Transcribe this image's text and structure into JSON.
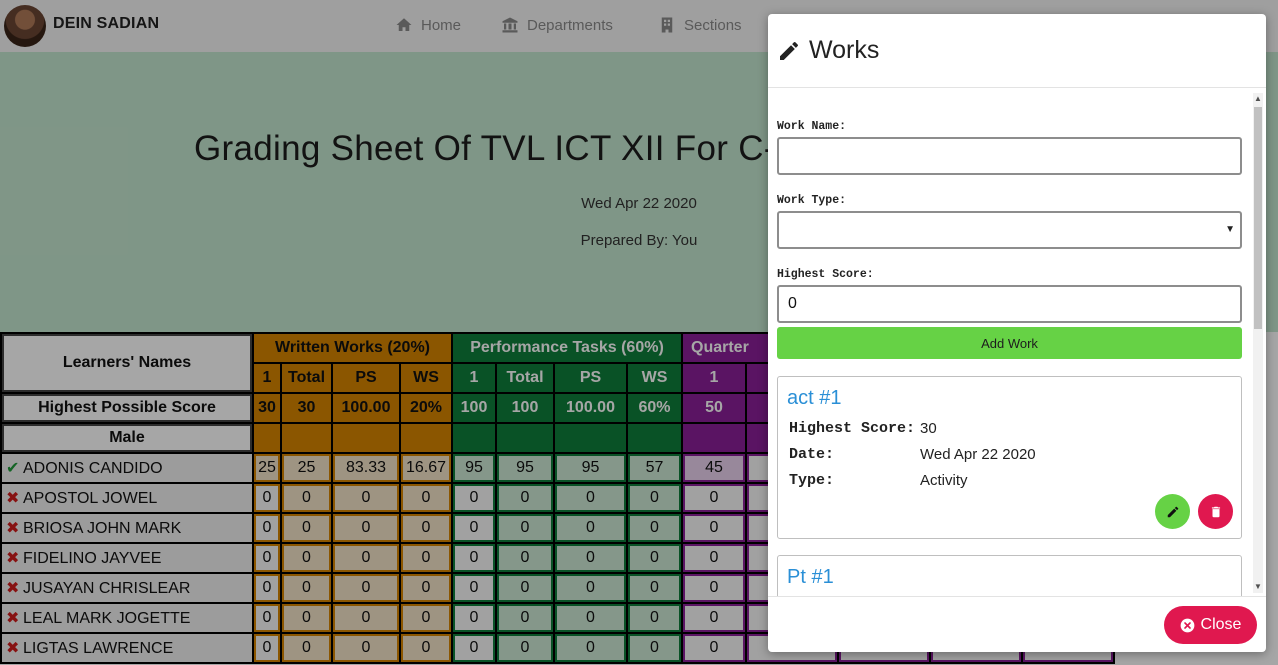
{
  "navbar": {
    "brand": "DEIN SADIAN",
    "links": [
      "Home",
      "Departments",
      "Sections"
    ]
  },
  "hero": {
    "title": "Grading Sheet Of TVL ICT XII For C-",
    "date": "Wed Apr 22 2020",
    "prepared_by": "Prepared By: You"
  },
  "sheet": {
    "names_header": "Learners' Names",
    "group_headers": [
      "Written Works (20%)",
      "Performance Tasks (60%)",
      "Quarter"
    ],
    "ww_cols": [
      "1",
      "Total",
      "PS",
      "WS"
    ],
    "pt_cols": [
      "1",
      "Total",
      "PS",
      "WS"
    ],
    "qa_cols": [
      "1"
    ],
    "hps_label": "Highest Possible Score",
    "hps": [
      "30",
      "30",
      "100.00",
      "20%",
      "100",
      "100",
      "100.00",
      "60%",
      "50"
    ],
    "male_label": "Male",
    "students": [
      {
        "name": "ADONIS CANDIDO",
        "ok": true,
        "scores": [
          "25",
          "25",
          "83.33",
          "16.67",
          "95",
          "95",
          "95",
          "57",
          "45"
        ]
      },
      {
        "name": "APOSTOL JOWEL",
        "ok": false,
        "scores": [
          "0",
          "0",
          "0",
          "0",
          "0",
          "0",
          "0",
          "0",
          "0"
        ]
      },
      {
        "name": "BRIOSA JOHN MARK",
        "ok": false,
        "scores": [
          "0",
          "0",
          "0",
          "0",
          "0",
          "0",
          "0",
          "0",
          "0"
        ]
      },
      {
        "name": "FIDELINO JAYVEE",
        "ok": false,
        "scores": [
          "0",
          "0",
          "0",
          "0",
          "0",
          "0",
          "0",
          "0",
          "0"
        ]
      },
      {
        "name": "JUSAYAN CHRISLEAR",
        "ok": false,
        "scores": [
          "0",
          "0",
          "0",
          "0",
          "0",
          "0",
          "0",
          "0",
          "0"
        ]
      },
      {
        "name": "LEAL MARK JOGETTE",
        "ok": false,
        "scores": [
          "0",
          "0",
          "0",
          "0",
          "0",
          "0",
          "0",
          "0",
          "0"
        ]
      },
      {
        "name": "LIGTAS LAWRENCE",
        "ok": false,
        "scores": [
          "0",
          "0",
          "0",
          "0",
          "0",
          "0",
          "0",
          "0",
          "0"
        ]
      }
    ]
  },
  "modal": {
    "title": "Works",
    "work_name_label": "Work Name:",
    "work_name_value": "",
    "work_type_label": "Work Type:",
    "work_type_value": "",
    "highest_score_label": "Highest Score:",
    "highest_score_value": "0",
    "add_button": "Add Work",
    "close_button": "Close",
    "works": [
      {
        "name": "act #1",
        "highest_score_key": "Highest Score:",
        "highest_score": "30",
        "date_key": "Date:",
        "date": "Wed Apr 22 2020",
        "type_key": "Type:",
        "type": "Activity"
      },
      {
        "name": "Pt #1"
      }
    ]
  },
  "colors": {
    "written_works": "#d68400",
    "performance_tasks": "#0f7f3b",
    "quarterly": "#8a1f98",
    "add_button": "#66d245",
    "danger": "#e0184f",
    "link": "#2a8fd6"
  }
}
